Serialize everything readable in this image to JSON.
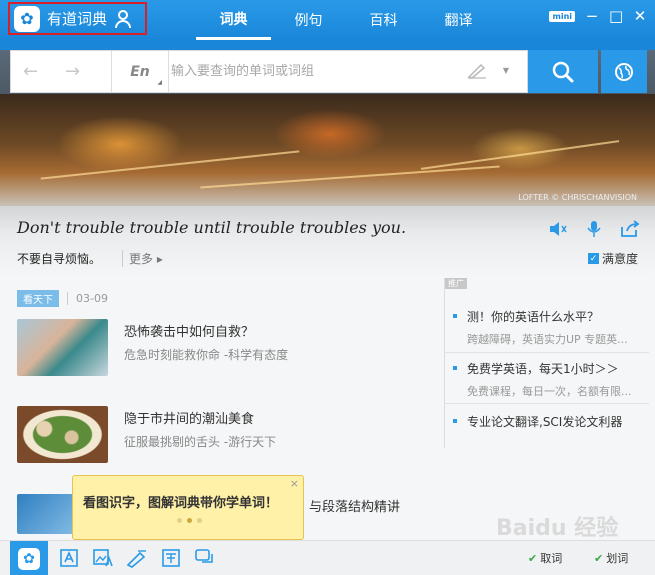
{
  "app": {
    "name": "有道词典",
    "logo_glyph": "✿",
    "accent_color": "#1a86d9"
  },
  "nav": {
    "tabs": [
      {
        "label": "词典",
        "active": true
      },
      {
        "label": "例句",
        "active": false
      },
      {
        "label": "百科",
        "active": false
      },
      {
        "label": "翻译",
        "active": false
      }
    ]
  },
  "window": {
    "mini_label": "mini",
    "minimize": "−",
    "maximize": "□",
    "close": "✕"
  },
  "search": {
    "back_icon": "←",
    "forward_icon": "→",
    "language": "En",
    "placeholder": "输入要查询的单词或词组",
    "value": ""
  },
  "banner": {
    "credit": "LOFTER © CHRISCHANVISION"
  },
  "quote": {
    "english": "Don't trouble trouble until trouble troubles you.",
    "chinese": "不要自寻烦恼。",
    "more_label": "更多",
    "satisfaction_label": "满意度",
    "satisfaction_checked": true
  },
  "feed": {
    "tag": "看天下",
    "date": "03-09",
    "articles": [
      {
        "title": "恐怖袭击中如何自救？",
        "subtitle": "危急时刻能救你命 -科学有态度"
      },
      {
        "title": "隐于市井间的潮汕美食",
        "subtitle": "征服最挑剔的舌头 -游行天下"
      },
      {
        "title": "与段落结构精讲",
        "subtitle": ""
      }
    ]
  },
  "sidebar": {
    "ad_label": "推广",
    "items": [
      {
        "title": "测！你的英语什么水平？",
        "subtitle": "跨越障碍，英语实力UP 专题英..."
      },
      {
        "title": "免费学英语，每天1小时＞＞",
        "subtitle": "免费课程，每日一次，名额有限..."
      },
      {
        "title": "专业论文翻译,SCI发论文利器",
        "subtitle": ""
      }
    ]
  },
  "tooltip": {
    "text": "看图识字，图解词典带你学单词！",
    "close": "×",
    "pages": 3,
    "current_page": 2
  },
  "bottom": {
    "status": [
      {
        "label": "取词",
        "check": "✔"
      },
      {
        "label": "划词",
        "check": "✔"
      }
    ]
  },
  "watermark": "Baidu 经验"
}
